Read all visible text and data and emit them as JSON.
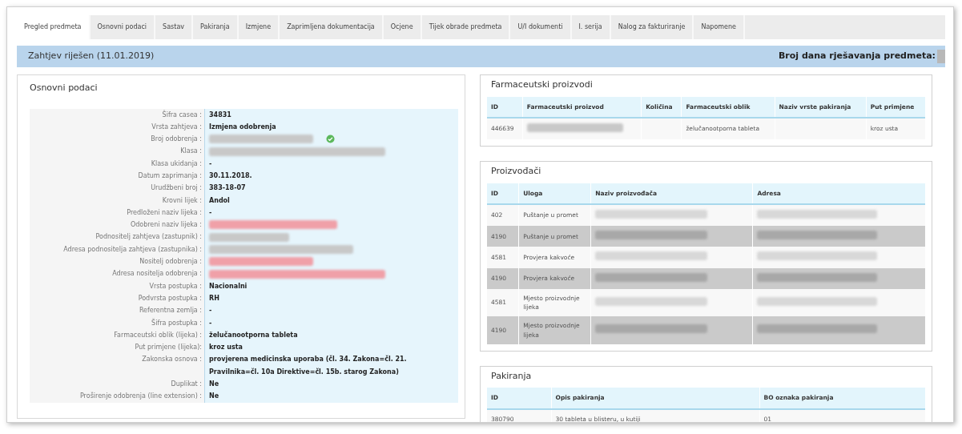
{
  "tabs": [
    {
      "label": "Pregled predmeta",
      "selected": true
    },
    {
      "label": "Osnovni podaci",
      "selected": false
    },
    {
      "label": "Sastav",
      "selected": false
    },
    {
      "label": "Pakiranja",
      "selected": false
    },
    {
      "label": "Izmjene",
      "selected": false
    },
    {
      "label": "Zaprimljena dokumentacija",
      "selected": false
    },
    {
      "label": "Ocjene",
      "selected": false
    },
    {
      "label": "Tijek obrade predmeta",
      "selected": false
    },
    {
      "label": "U/I dokumenti",
      "selected": false
    },
    {
      "label": "I. serija",
      "selected": false
    },
    {
      "label": "Nalog za fakturiranje",
      "selected": false
    },
    {
      "label": "Napomene",
      "selected": false
    }
  ],
  "status_bar": {
    "title": "Zahtjev riješen (11.01.2019)",
    "right_label": "Broj dana rješavanja predmeta:"
  },
  "basic_data": {
    "title": "Osnovni podaci",
    "fields": [
      {
        "label": "Šifra casea :",
        "kind": "text",
        "value": "34831"
      },
      {
        "label": "Vrsta zahtjeva :",
        "kind": "text",
        "value": "Izmjena odobrenja"
      },
      {
        "label": "Broj odobrenja :",
        "kind": "redacted",
        "color": "#c8c8c8",
        "verified": true
      },
      {
        "label": "Klasa :",
        "kind": "redacted",
        "color": "#c8c8c8"
      },
      {
        "label": "Klasa ukidanja :",
        "kind": "text",
        "value": "-"
      },
      {
        "label": "Datum zaprimanja :",
        "kind": "text",
        "value": "30.11.2018."
      },
      {
        "label": "Urudžbeni broj :",
        "kind": "text",
        "value": "383-18-07"
      },
      {
        "label": "Krovni lijek :",
        "kind": "text",
        "value": "Andol"
      },
      {
        "label": "Predloženi naziv lijeka :",
        "kind": "text",
        "value": "-"
      },
      {
        "label": "Odobreni naziv lijeka :",
        "kind": "redacted",
        "color": "#f0a0a8"
      },
      {
        "label": "Podnositelj zahtjeva (zastupnik) :",
        "kind": "redacted",
        "color": "#c8c8c8"
      },
      {
        "label": "Adresa podnositelja zahtjeva (zastupnika) :",
        "kind": "redacted",
        "color": "#c8c8c8"
      },
      {
        "label": "Nositelj odobrenja :",
        "kind": "redacted",
        "color": "#f0a0a8"
      },
      {
        "label": "Adresa nositelja odobrenja :",
        "kind": "redacted",
        "color": "#f0a0a8"
      },
      {
        "label": "Vrsta postupka :",
        "kind": "text",
        "value": "Nacionalni"
      },
      {
        "label": "Podvrsta postupka :",
        "kind": "text",
        "value": "RH"
      },
      {
        "label": "Referentna zemlja :",
        "kind": "text",
        "value": "-"
      },
      {
        "label": "Šifra postupka :",
        "kind": "text",
        "value": "-"
      },
      {
        "label": "Farmaceutski oblik (lijeka) :",
        "kind": "text",
        "value": "želučanootporna tableta"
      },
      {
        "label": "Put primjene (lijeka):",
        "kind": "text",
        "value": "kroz usta"
      },
      {
        "label": "Zakonska osnova :",
        "kind": "text",
        "value": "provjerena medicinska uporaba (čl. 34. Zakona=čl. 21. Pravilnika=čl. 10a Direktive=čl. 15b. starog Zakona)"
      },
      {
        "label": "Duplikat :",
        "kind": "text",
        "value": "Ne"
      },
      {
        "label": "Proširenje odobrenja (line extension) :",
        "kind": "text",
        "value": "Ne"
      }
    ]
  },
  "products": {
    "title": "Farmaceutski proizvodi",
    "columns": [
      "ID",
      "Farmaceutski proizvod",
      "Količina",
      "Farmaceutski oblik",
      "Naziv vrste pakiranja",
      "Put primjene"
    ],
    "rows": [
      {
        "shaded": false,
        "cells": [
          {
            "kind": "text",
            "value": "446639"
          },
          {
            "kind": "redacted",
            "color": "#c8c8c8"
          },
          {
            "kind": "empty"
          },
          {
            "kind": "text",
            "value": "želučanootporna tableta"
          },
          {
            "kind": "empty"
          },
          {
            "kind": "text",
            "value": "kroz usta"
          }
        ]
      }
    ]
  },
  "manufacturers": {
    "title": "Proizvođači",
    "columns": [
      "ID",
      "Uloga",
      "Naziv proizvođača",
      "Adresa"
    ],
    "rows": [
      {
        "shaded": false,
        "cells": [
          {
            "kind": "text",
            "value": "402"
          },
          {
            "kind": "text",
            "value": "Puštanje u promet"
          },
          {
            "kind": "redacted",
            "color": "#d8d8d8"
          },
          {
            "kind": "redacted",
            "color": "#d8d8d8"
          }
        ]
      },
      {
        "shaded": true,
        "cells": [
          {
            "kind": "text",
            "value": "4190"
          },
          {
            "kind": "text",
            "value": "Puštanje u promet"
          },
          {
            "kind": "redacted",
            "color": "#a8a8a8"
          },
          {
            "kind": "redacted",
            "color": "#a8a8a8"
          }
        ]
      },
      {
        "shaded": false,
        "cells": [
          {
            "kind": "text",
            "value": "4581"
          },
          {
            "kind": "text",
            "value": "Provjera kakvoće"
          },
          {
            "kind": "redacted",
            "color": "#d8d8d8"
          },
          {
            "kind": "redacted",
            "color": "#d8d8d8"
          }
        ]
      },
      {
        "shaded": true,
        "cells": [
          {
            "kind": "text",
            "value": "4190"
          },
          {
            "kind": "text",
            "value": "Provjera kakvoće"
          },
          {
            "kind": "redacted",
            "color": "#a8a8a8"
          },
          {
            "kind": "redacted",
            "color": "#a8a8a8"
          }
        ]
      },
      {
        "shaded": false,
        "cells": [
          {
            "kind": "text",
            "value": "4581"
          },
          {
            "kind": "text",
            "value": "Mjesto proizvodnje lijeka"
          },
          {
            "kind": "redacted",
            "color": "#d8d8d8"
          },
          {
            "kind": "redacted",
            "color": "#d8d8d8"
          }
        ]
      },
      {
        "shaded": true,
        "cells": [
          {
            "kind": "text",
            "value": "4190"
          },
          {
            "kind": "text",
            "value": "Mjesto proizvodnje lijeka"
          },
          {
            "kind": "redacted",
            "color": "#a8a8a8"
          },
          {
            "kind": "redacted",
            "color": "#a8a8a8"
          }
        ]
      }
    ]
  },
  "packaging": {
    "title": "Pakiranja",
    "columns": [
      "ID",
      "Opis pakiranja",
      "BO oznaka pakiranja"
    ],
    "rows": [
      {
        "shaded": false,
        "cells": [
          {
            "kind": "text",
            "value": "380790"
          },
          {
            "kind": "text",
            "value": "30 tableta u blisteru, u kutiji"
          },
          {
            "kind": "text",
            "value": "01"
          }
        ]
      }
    ]
  }
}
